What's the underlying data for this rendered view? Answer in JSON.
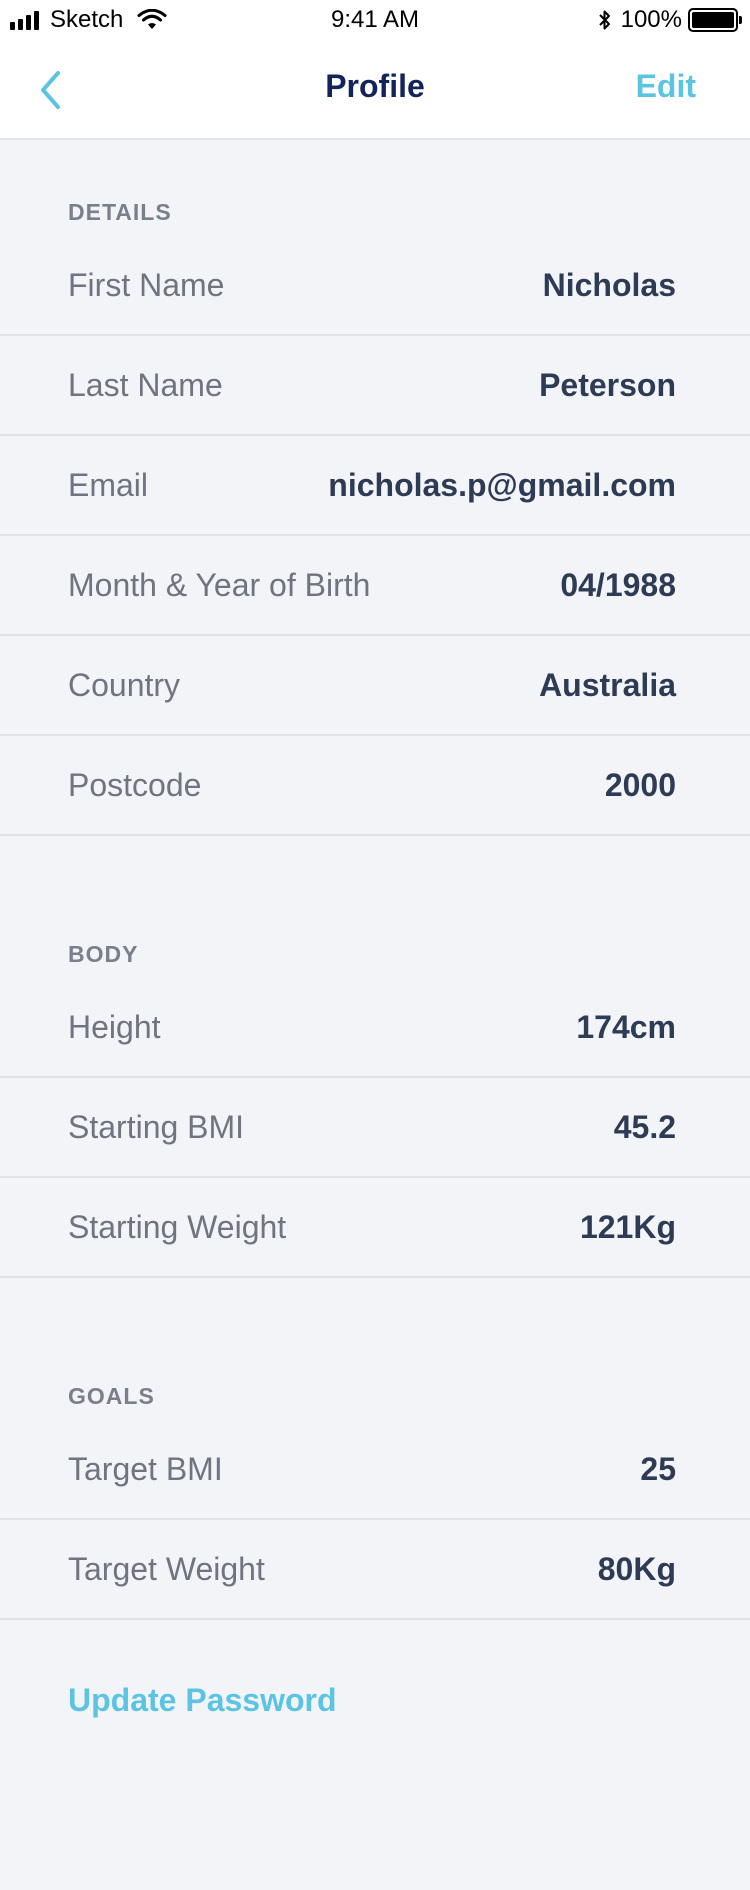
{
  "status_bar": {
    "carrier": "Sketch",
    "time": "9:41 AM",
    "battery": "100%"
  },
  "nav": {
    "title": "Profile",
    "edit_label": "Edit"
  },
  "sections": {
    "details": {
      "header": "DETAILS",
      "rows": [
        {
          "label": "First Name",
          "value": "Nicholas"
        },
        {
          "label": "Last Name",
          "value": "Peterson"
        },
        {
          "label": "Email",
          "value": "nicholas.p@gmail.com"
        },
        {
          "label": "Month & Year of Birth",
          "value": "04/1988"
        },
        {
          "label": "Country",
          "value": "Australia"
        },
        {
          "label": "Postcode",
          "value": "2000"
        }
      ]
    },
    "body": {
      "header": "BODY",
      "rows": [
        {
          "label": "Height",
          "value": "174cm"
        },
        {
          "label": "Starting BMI",
          "value": "45.2"
        },
        {
          "label": "Starting Weight",
          "value": "121Kg"
        }
      ]
    },
    "goals": {
      "header": "GOALS",
      "rows": [
        {
          "label": "Target BMI",
          "value": "25"
        },
        {
          "label": "Target Weight",
          "value": "80Kg"
        }
      ]
    }
  },
  "actions": {
    "update_password": "Update Password"
  },
  "colors": {
    "accent": "#5bc4e3",
    "title": "#14245a",
    "value": "#2e3b55",
    "label": "#6f7480",
    "background": "#f2f4f8"
  },
  "icons": {
    "back": "chevron-left-icon",
    "signal": "signal-icon",
    "wifi": "wifi-icon",
    "bluetooth": "bluetooth-icon",
    "battery": "battery-icon"
  }
}
